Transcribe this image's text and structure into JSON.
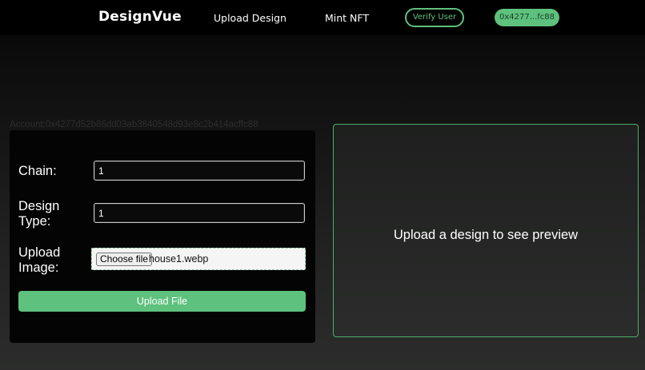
{
  "nav": {
    "brand": "DesignVue",
    "links": [
      "Upload Design",
      "Mint NFT"
    ],
    "verify_label": "Verify User",
    "wallet_label": "0x4277...fc88"
  },
  "account_text": "Account:0x4277d52b86dd03ab3840548d93e8c2b414acffc88",
  "form": {
    "chain_label": "Chain:",
    "chain_value": "1",
    "design_type_label": "Design Type:",
    "design_type_value": "1",
    "upload_image_label": "Upload Image:",
    "choose_file_label": "Choose file",
    "file_name": "house1.webp",
    "submit_label": "Upload File"
  },
  "preview": {
    "placeholder": "Upload a design to see preview"
  },
  "colors": {
    "accent": "#5ec17d",
    "nav_bg": "#000000",
    "panel_bg": "#040404"
  }
}
